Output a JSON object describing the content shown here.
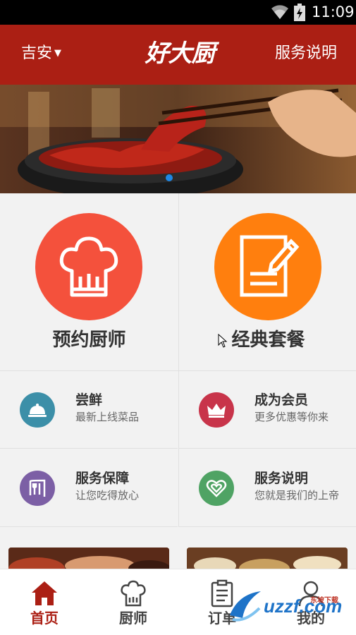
{
  "status_bar": {
    "time": "11:09"
  },
  "header": {
    "location": "吉安",
    "brand": "好大厨",
    "service_link": "服务说明"
  },
  "features": [
    {
      "label": "预约厨师",
      "icon": "chef-hat-icon",
      "color": "#f4513c"
    },
    {
      "label": "经典套餐",
      "icon": "document-edit-icon",
      "color": "#ff7f0e"
    }
  ],
  "menu": [
    {
      "title": "尝鲜",
      "subtitle": "最新上线菜品",
      "icon": "dish-cover-icon",
      "color": "#3c8fa8"
    },
    {
      "title": "成为会员",
      "subtitle": "更多优惠等你来",
      "icon": "crown-icon",
      "color": "#c8344a"
    },
    {
      "title": "服务保障",
      "subtitle": "让您吃得放心",
      "icon": "fork-knife-icon",
      "color": "#7c5fa5"
    },
    {
      "title": "服务说明",
      "subtitle": "您就是我们的上帝",
      "icon": "heart-icon",
      "color": "#4fa364"
    }
  ],
  "tabs": [
    {
      "label": "首页",
      "icon": "home-icon",
      "active": true
    },
    {
      "label": "厨师",
      "icon": "chef-hat-icon",
      "active": false
    },
    {
      "label": "订单",
      "icon": "clipboard-icon",
      "active": false
    },
    {
      "label": "我的",
      "icon": "user-icon",
      "active": false
    }
  ],
  "watermark": {
    "text": "uzzf.com",
    "small": "东坡下载"
  },
  "colors": {
    "brand_red": "#ab1f14",
    "background": "#f2f2f2"
  }
}
